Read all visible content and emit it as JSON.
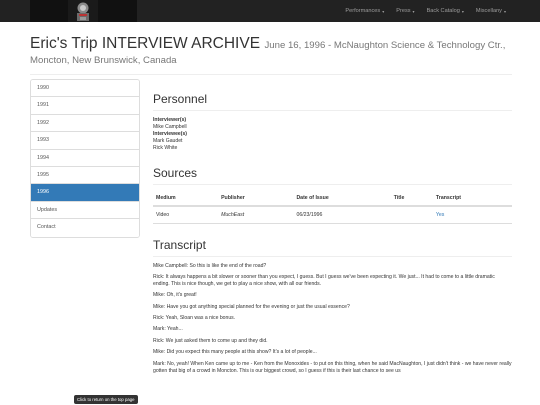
{
  "navbar": {
    "logo": "logo",
    "items": [
      {
        "label": "Performances"
      },
      {
        "label": "Press"
      },
      {
        "label": "Back Catalog"
      },
      {
        "label": "Miscellany"
      }
    ]
  },
  "header": {
    "title": "Eric's Trip INTERVIEW ARCHIVE",
    "subtitle_1": "June 16, 1996 - McNaughton Science & Technology Ctr.,",
    "subtitle_2": "Moncton, New Brunswick, Canada"
  },
  "sidebar": {
    "items": [
      {
        "label": "1990"
      },
      {
        "label": "1991"
      },
      {
        "label": "1992"
      },
      {
        "label": "1993"
      },
      {
        "label": "1994"
      },
      {
        "label": "1995"
      },
      {
        "label": "1996"
      },
      {
        "label": "Updates"
      },
      {
        "label": "Contact"
      }
    ],
    "active_index": 6
  },
  "personnel": {
    "heading": "Personnel",
    "interviewer_label": "Interviewer(s)",
    "interviewer": "Mike Campbell",
    "interviewee_label": "Interviewee(s)",
    "interviewee_1": "Mark Gaudet",
    "interviewee_2": "Rick White"
  },
  "sources": {
    "heading": "Sources",
    "columns": [
      "Medium",
      "Publisher",
      "Date of Issue",
      "Title",
      "Transcript"
    ],
    "rows": [
      {
        "medium": "Video",
        "publisher": "MuchEast",
        "date": "06/23/1996",
        "title": "",
        "transcript": "Yes"
      }
    ]
  },
  "transcript": {
    "heading": "Transcript",
    "lines": [
      "Mike Campbell: So this is like the end of the road?",
      "Rick: It always happens a bit slower or sooner than you expect, I guess. But I guess we've been expecting it. We just... It had to come to a little dramatic ending. This is nice though, we get to play a nice show, with all our friends.",
      "Mike: Oh, it's great!",
      "Mike: Have you got anything special planned for the evening or just the usual essence?",
      "Rick: Yeah, Sloan was a nice bonus.",
      "Mark: Yeah...",
      "Rick: We just asked them to come up and they did.",
      "Mike: Did you expect this many people at this show? It's a lot of people...",
      "Mark: No, yeah! When Ken came up to me - Ken from the Monoxides - to put on this thing, when he said MacNaughton, I just didn't think - we have never really gotten that big of a crowd in Moncton. This is our biggest crowd, so I guess if this is their last chance to see us"
    ]
  },
  "return_top": "Click to return on the top page"
}
